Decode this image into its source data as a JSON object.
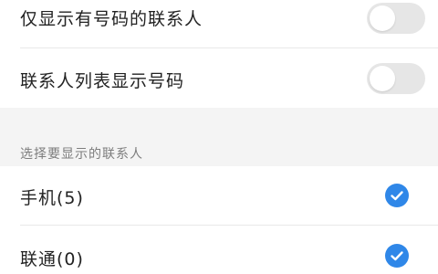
{
  "settings": {
    "only_with_number": {
      "label": "仅显示有号码的联系人",
      "enabled": false
    },
    "show_number_in_list": {
      "label": "联系人列表显示号码",
      "enabled": false
    }
  },
  "contacts_section": {
    "header": "选择要显示的联系人",
    "items": [
      {
        "label": "手机(5)",
        "checked": true
      },
      {
        "label": "联通(0)",
        "checked": true
      }
    ]
  },
  "colors": {
    "accent": "#2f87e8",
    "toggle_off": "#e6e6e6",
    "section_bg": "#f4f4f4"
  },
  "icons": {
    "toggle": "toggle-switch-icon",
    "check": "checkmark-circle-icon"
  }
}
